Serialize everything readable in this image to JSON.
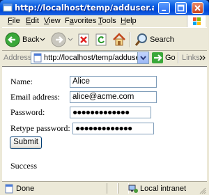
{
  "window": {
    "title": "http://localhost/temp/adduser.aspx - Micr..."
  },
  "menubar": {
    "items": [
      {
        "label_u": "F",
        "label_rest": "ile"
      },
      {
        "label_u": "E",
        "label_rest": "dit"
      },
      {
        "label_u": "V",
        "label_rest": "iew"
      },
      {
        "label_pre": "F",
        "label_u": "a",
        "label_rest": "vorites"
      },
      {
        "label_u": "T",
        "label_rest": "ools"
      },
      {
        "label_u": "H",
        "label_rest": "elp"
      }
    ]
  },
  "toolbar": {
    "back_label": "Back",
    "search_label": "Search"
  },
  "address": {
    "label": "Address",
    "url": "http://localhost/temp/adduser.aspx",
    "go_label": "Go",
    "links_label": "Links"
  },
  "form": {
    "name_label": "Name:",
    "name_value": "Alice",
    "email_label": "Email address:",
    "email_value": "alice@acme.com",
    "password_label": "Password:",
    "password_value": "●●●●●●●●●●●●●",
    "retype_label": "Retype password:",
    "retype_value": "●●●●●●●●●●●●●",
    "submit_label": "Submit",
    "result_text": "Success"
  },
  "status": {
    "left_text": "Done",
    "zone_text": "Local intranet"
  },
  "colors": {
    "titlebar": "#0054e3",
    "frame": "#ece9d8",
    "input_border": "#7f9db9"
  }
}
